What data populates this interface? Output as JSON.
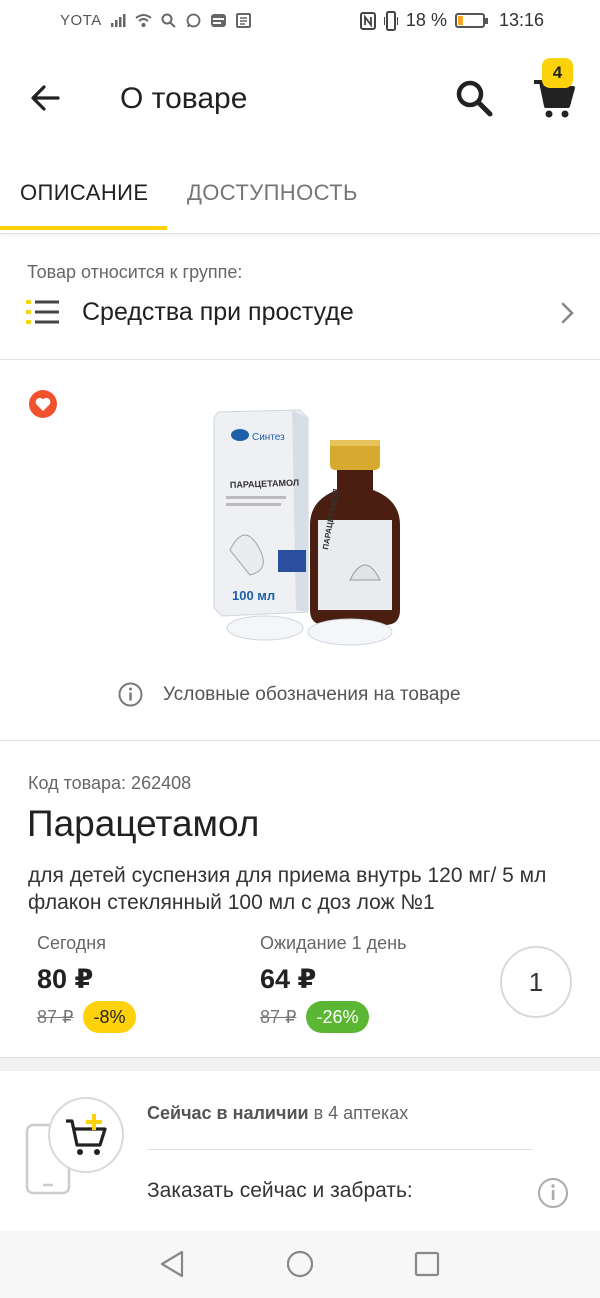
{
  "status_bar": {
    "carrier": "YOTA",
    "battery_percent": "18 %",
    "time": "13:16"
  },
  "app_bar": {
    "title": "О товаре",
    "cart_count": "4"
  },
  "tabs": [
    {
      "label": "ОПИСАНИЕ",
      "active": true
    },
    {
      "label": "ДОСТУПНОСТЬ",
      "active": false
    }
  ],
  "group": {
    "caption": "Товар относится к группе:",
    "name": "Средства при простуде"
  },
  "image_section": {
    "legend_text": "Условные обозначения на товаре",
    "box_brand": "Синтез",
    "box_name": "ПАРАЦЕТАМОЛ",
    "box_volume": "100 мл"
  },
  "product": {
    "code": "Код товара: 262408",
    "name": "Парацетамол",
    "description": "для детей  суспензия для приема внутрь 120 мг/ 5 мл флакон стеклянный 100 мл с доз лож №1",
    "prices": [
      {
        "label": "Сегодня",
        "price": "80 ₽",
        "old_price": "87 ₽",
        "discount": "-8%"
      },
      {
        "label": "Ожидание 1 день",
        "price": "64 ₽",
        "old_price": "87 ₽",
        "discount": "-26%"
      }
    ],
    "quantity": "1"
  },
  "availability": {
    "bold_text": "Сейчас в наличии",
    "rest_text": " в 4 аптеках",
    "order_text": "Заказать сейчас и забрать:"
  },
  "colors": {
    "accent": "#fdd20a",
    "favorite": "#f0522e",
    "discount_green": "#5bb634"
  }
}
